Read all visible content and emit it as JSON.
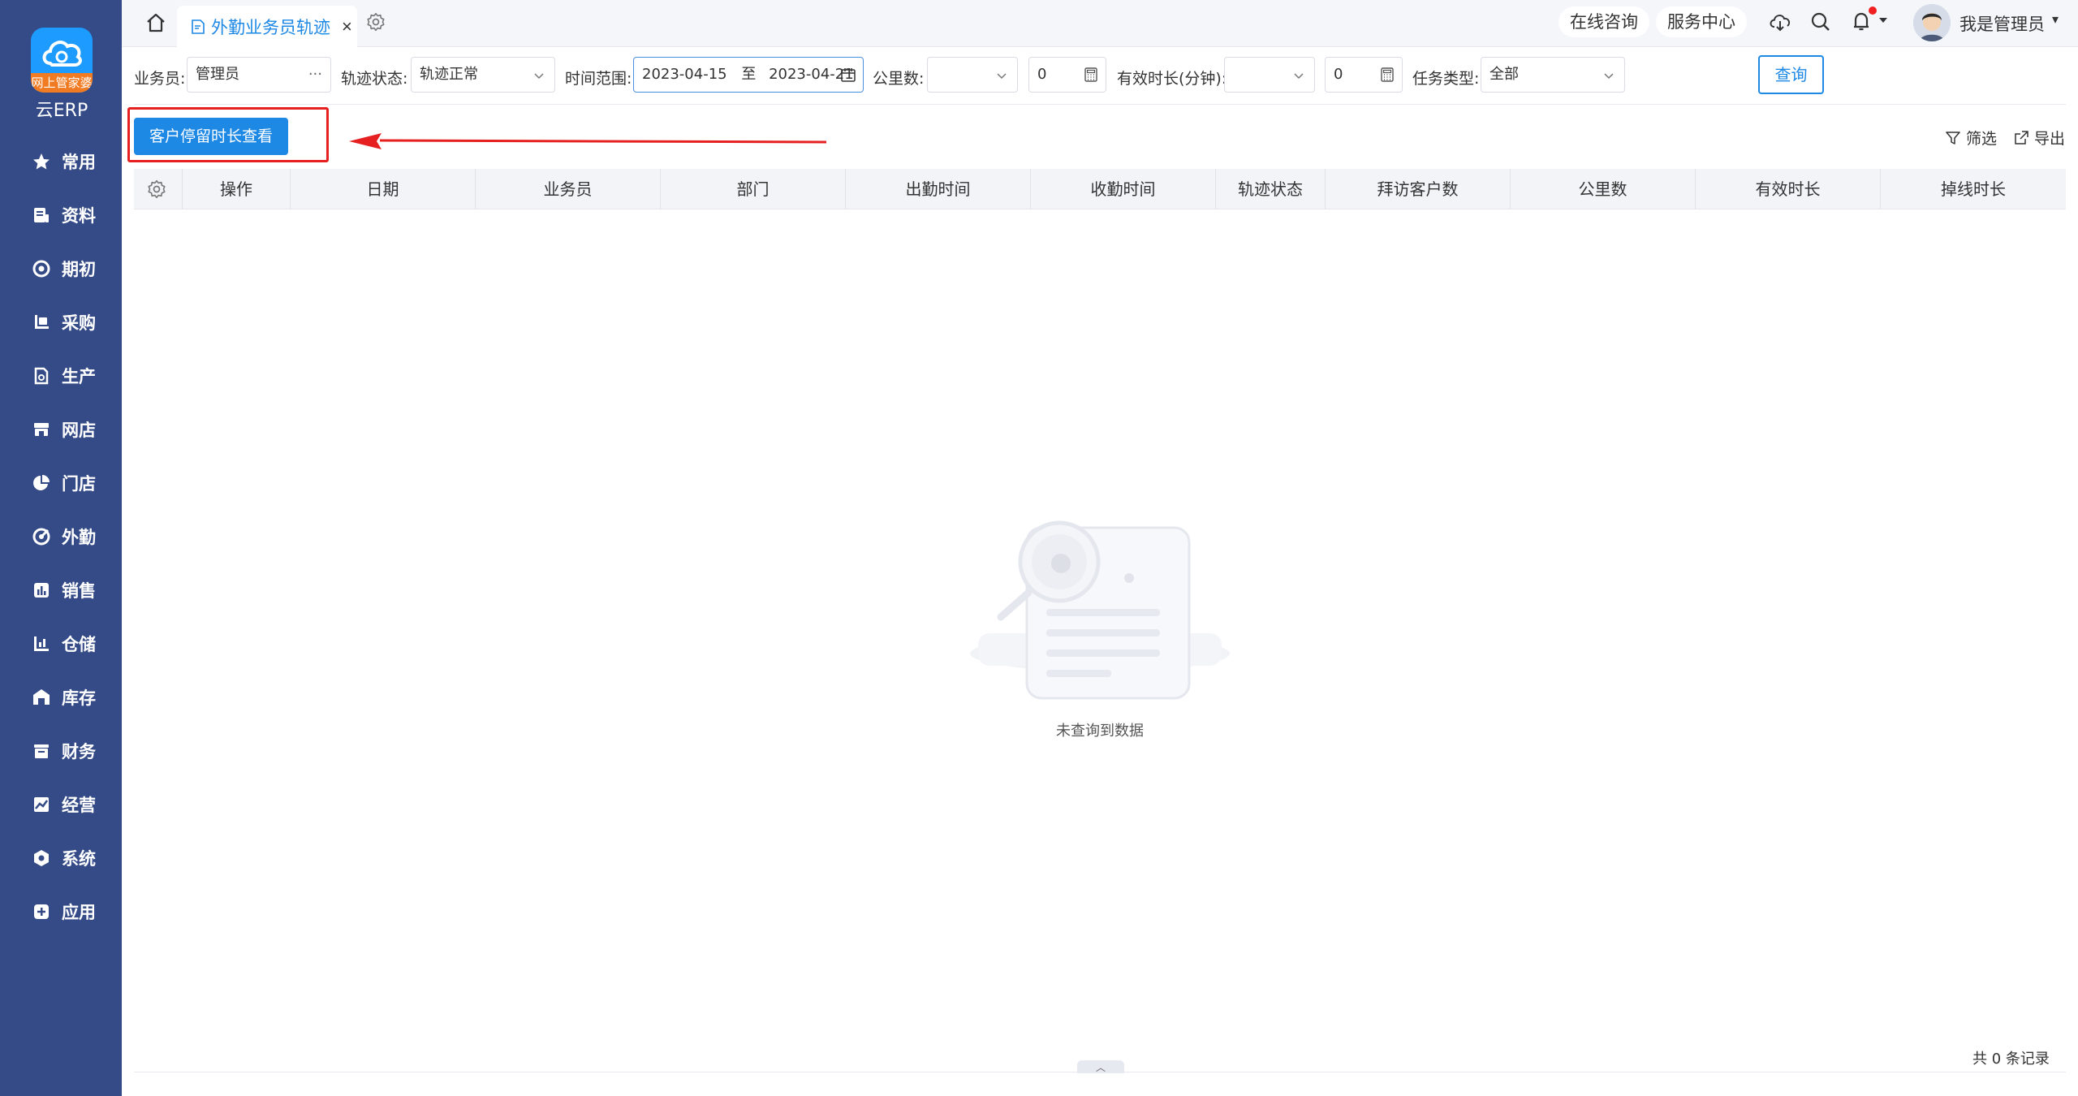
{
  "brand": {
    "logo_band_text": "网上管家婆",
    "logo_text": "云ERP",
    "accent_color": "#1e88e5",
    "sidebar_color": "#344b87"
  },
  "sidebar": {
    "items": [
      {
        "label": "常用",
        "icon": "star-icon"
      },
      {
        "label": "资料",
        "icon": "document-icon"
      },
      {
        "label": "期初",
        "icon": "target-icon"
      },
      {
        "label": "采购",
        "icon": "purchase-icon"
      },
      {
        "label": "生产",
        "icon": "production-icon"
      },
      {
        "label": "网店",
        "icon": "shop-icon"
      },
      {
        "label": "门店",
        "icon": "store-pie-icon"
      },
      {
        "label": "外勤",
        "icon": "field-icon"
      },
      {
        "label": "销售",
        "icon": "sales-icon"
      },
      {
        "label": "仓储",
        "icon": "warehouse-icon"
      },
      {
        "label": "库存",
        "icon": "inventory-icon"
      },
      {
        "label": "财务",
        "icon": "finance-icon"
      },
      {
        "label": "经营",
        "icon": "operation-icon"
      },
      {
        "label": "系统",
        "icon": "system-icon"
      },
      {
        "label": "应用",
        "icon": "apps-icon"
      }
    ]
  },
  "topbar": {
    "tab_label": "外勤业务员轨迹",
    "tab_close": "×",
    "online_consult": "在线咨询",
    "service_center": "服务中心",
    "user_name": "我是管理员"
  },
  "filters": {
    "salesman_label": "业务员:",
    "salesman_value": "管理员",
    "salesman_suffix": "···",
    "track_status_label": "轨迹状态:",
    "track_status_value": "轨迹正常",
    "time_range_label": "时间范围:",
    "date_from": "2023-04-15",
    "date_to_sep": "至",
    "date_to": "2023-04-21",
    "km_label": "公里数:",
    "km_operator": "",
    "km_value": "0",
    "duration_label": "有效时长(分钟):",
    "duration_operator": "",
    "duration_value": "0",
    "task_type_label": "任务类型:",
    "task_type_value": "全部",
    "query_button": "查询"
  },
  "actions": {
    "stay_duration_button": "客户停留时长查看",
    "filter_link": "筛选",
    "export_link": "导出"
  },
  "table": {
    "columns": [
      "操作",
      "日期",
      "业务员",
      "部门",
      "出勤时间",
      "收勤时间",
      "轨迹状态",
      "拜访客户数",
      "公里数",
      "有效时长",
      "掉线时长"
    ]
  },
  "empty_state": {
    "text": "未查询到数据"
  },
  "footer": {
    "record_count": "共 0 条记录"
  }
}
